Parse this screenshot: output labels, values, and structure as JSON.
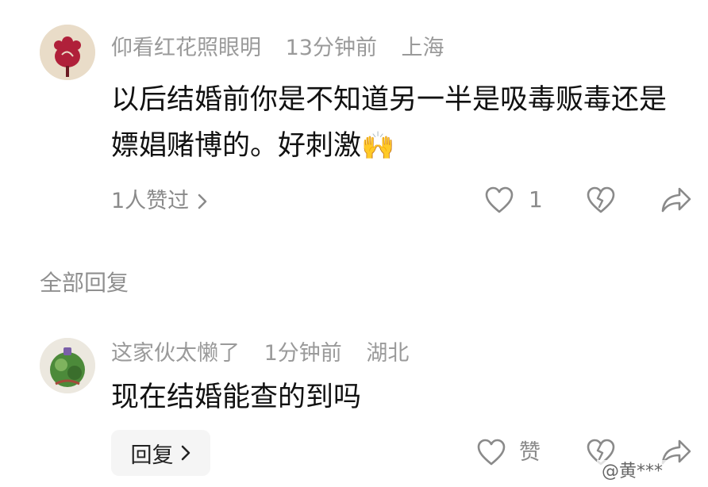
{
  "comment": {
    "username": "仰看红花照眼明",
    "time": "13分钟前",
    "location": "上海",
    "text": "以后结婚前你是不知道另一半是吸毒贩毒还是嫖娼赌博的。好刺激",
    "emoji": "🙌",
    "likers": "1人赞过",
    "like_count": "1"
  },
  "section_title": "全部回复",
  "reply": {
    "username": "这家伙太懒了",
    "time": "1分钟前",
    "location": "湖北",
    "text": "现在结婚能查的到吗",
    "reply_button": "回复",
    "like_label": "赞"
  },
  "watermark": "@黄***",
  "colors": {
    "meta_text": "#9a9a9a",
    "body_text": "#111111",
    "icon": "#8a8a8a",
    "avatar1_bg": "#e9dcc8",
    "avatar1_flower": "#b0203a",
    "avatar2_bg": "#ece8df",
    "avatar2_leaf": "#4c8a3a"
  }
}
